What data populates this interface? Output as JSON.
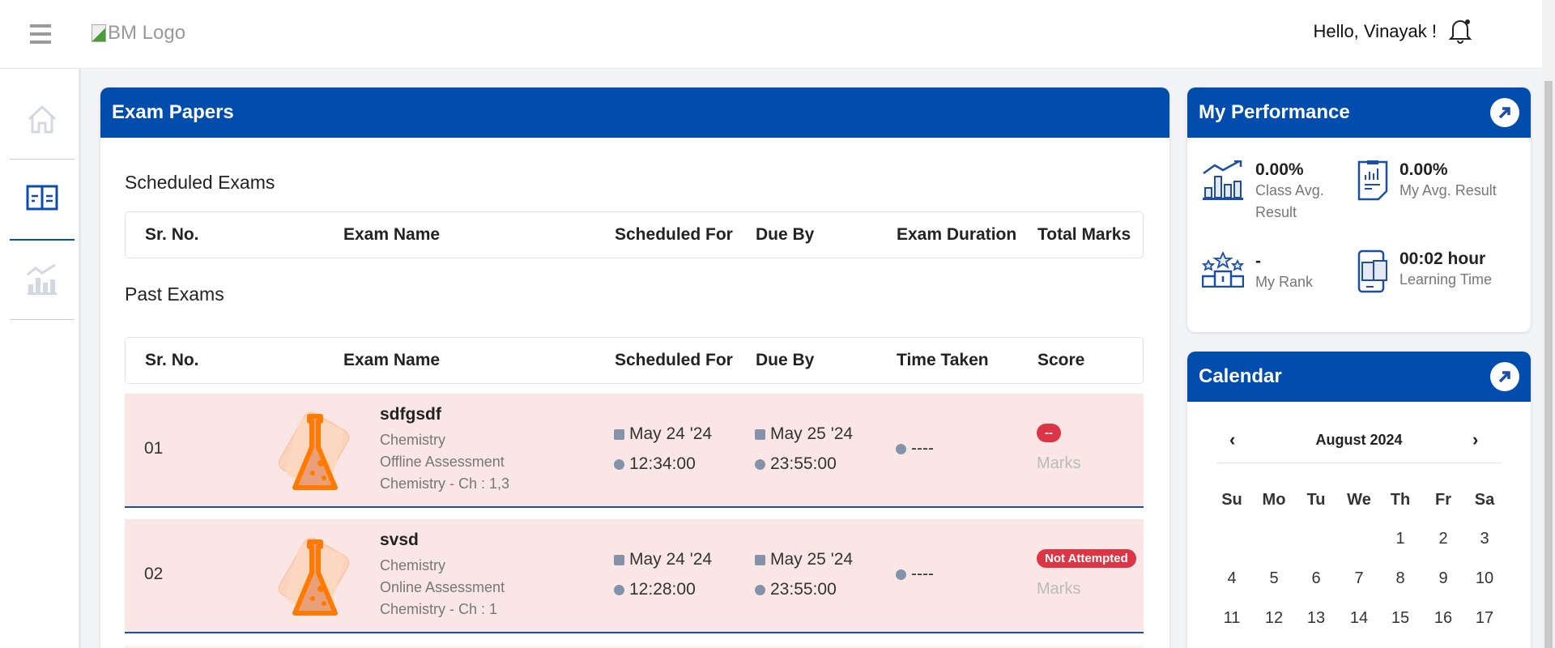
{
  "header": {
    "logo_alt": "BM Logo",
    "greeting": "Hello, Vinayak !"
  },
  "sidebar": {
    "items": [
      {
        "name": "home"
      },
      {
        "name": "exam-papers",
        "active": true
      },
      {
        "name": "performance"
      }
    ]
  },
  "exam_papers": {
    "title": "Exam Papers",
    "scheduled": {
      "title": "Scheduled Exams",
      "columns": [
        "Sr. No.",
        "Exam Name",
        "Scheduled For",
        "Due By",
        "Exam Duration",
        "Total Marks"
      ]
    },
    "past": {
      "title": "Past Exams",
      "columns": [
        "Sr. No.",
        "Exam Name",
        "Scheduled For",
        "Due By",
        "Time Taken",
        "Score"
      ],
      "rows": [
        {
          "sr": "01",
          "name": "sdfgsdf",
          "subject": "Chemistry",
          "type": "Offline Assessment",
          "chapters": "Chemistry - Ch : 1,3",
          "sched_date": "May 24 '24",
          "sched_time": "12:34:00",
          "due_date": "May 25 '24",
          "due_time": "23:55:00",
          "time_taken": "----",
          "score_badge": "--",
          "score_label": "Marks"
        },
        {
          "sr": "02",
          "name": "svsd",
          "subject": "Chemistry",
          "type": "Online Assessment",
          "chapters": "Chemistry - Ch : 1",
          "sched_date": "May 24 '24",
          "sched_time": "12:28:00",
          "due_date": "May 25 '24",
          "due_time": "23:55:00",
          "time_taken": "----",
          "score_badge": "Not Attempted",
          "score_label": "Marks"
        }
      ]
    }
  },
  "performance": {
    "title": "My Performance",
    "items": [
      {
        "value": "0.00%",
        "label": "Class Avg. Result"
      },
      {
        "value": "0.00%",
        "label": "My Avg. Result"
      },
      {
        "value": "-",
        "label": "My Rank"
      },
      {
        "value": "00:02 hour",
        "label": "Learning Time"
      }
    ]
  },
  "calendar": {
    "title": "Calendar",
    "month": "August 2024",
    "weekdays": [
      "Su",
      "Mo",
      "Tu",
      "We",
      "Th",
      "Fr",
      "Sa"
    ],
    "weeks": [
      [
        "",
        "",
        "",
        "",
        "1",
        "2",
        "3"
      ],
      [
        "4",
        "5",
        "6",
        "7",
        "8",
        "9",
        "10"
      ],
      [
        "11",
        "12",
        "13",
        "14",
        "15",
        "16",
        "17"
      ]
    ]
  },
  "colors": {
    "primary": "#004dad",
    "row_bg": "#fbe6e6",
    "danger": "#dc3545",
    "flask": "#ff7a00"
  }
}
